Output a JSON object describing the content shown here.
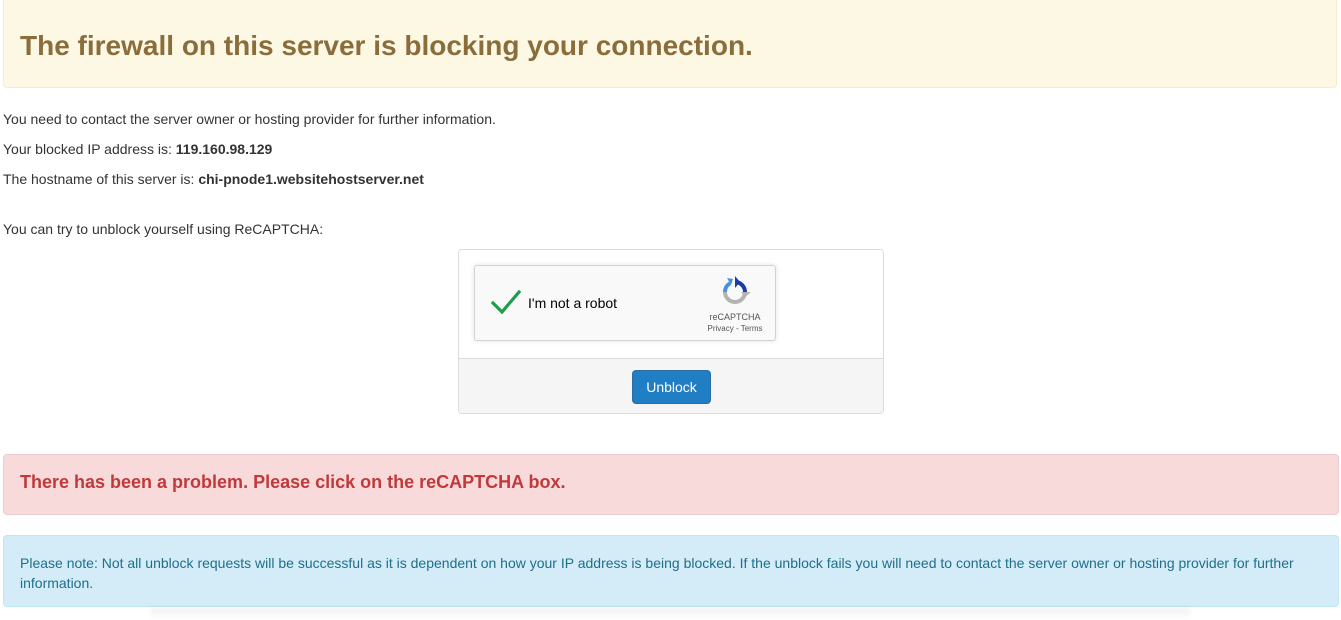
{
  "header": {
    "title": "The firewall on this server is blocking your connection."
  },
  "info": {
    "contact_line": "You need to contact the server owner or hosting provider for further information.",
    "ip_label": "Your blocked IP address is: ",
    "ip_value": "119.160.98.129",
    "hostname_label": "The hostname of this server is: ",
    "hostname_value": "chi-pnode1.websitehostserver.net",
    "unblock_prompt": "You can try to unblock yourself using ReCAPTCHA:"
  },
  "recaptcha": {
    "label": "I'm not a robot",
    "brand": "reCAPTCHA",
    "terms": "Privacy - Terms",
    "checked": true,
    "check_icon": "checkmark-icon",
    "logo_icon": "recaptcha-logo-icon",
    "check_color": "#1e9e4a"
  },
  "actions": {
    "unblock_label": "Unblock"
  },
  "error": {
    "message": "There has been a problem. Please click on the reCAPTCHA box."
  },
  "note": {
    "message": "Please note: Not all unblock requests will be successful as it is dependent on how your IP address is being blocked. If the unblock fails you will need to contact the server owner or hosting provider for further information."
  },
  "colors": {
    "warning_bg": "#fcf8e3",
    "warning_text": "#8a6d3b",
    "danger_bg": "#f8dadb",
    "danger_text": "#c0393b",
    "info_bg": "#d3ecf7",
    "info_text": "#1f6f8b",
    "button_bg": "#1f7ec4"
  }
}
